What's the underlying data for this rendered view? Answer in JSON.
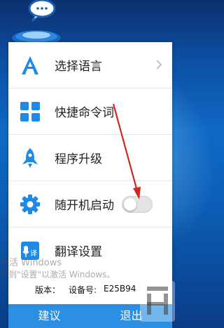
{
  "menu": {
    "items": [
      {
        "label": "选择语言",
        "icon": "letter-a-icon"
      },
      {
        "label": "快捷命令词",
        "icon": "grid-icon"
      },
      {
        "label": "程序升级",
        "icon": "rocket-icon"
      },
      {
        "label": "随开机启动",
        "icon": "gear-icon"
      },
      {
        "label": "翻译设置",
        "icon": "translate-icon"
      }
    ],
    "toggle_state": "off"
  },
  "watermark": {
    "line1": "激活 Windows",
    "line2": "转到\"设置\"以激活 Windows。"
  },
  "version": {
    "label": "版本：",
    "device_label": "设备号:",
    "device_id": "E25B94"
  },
  "bottom": {
    "suggest": "建议",
    "exit": "退出"
  },
  "colors": {
    "accent": "#2b8fe3",
    "icon_blue": "#1f8ae6",
    "arrow": "#d0281f"
  }
}
